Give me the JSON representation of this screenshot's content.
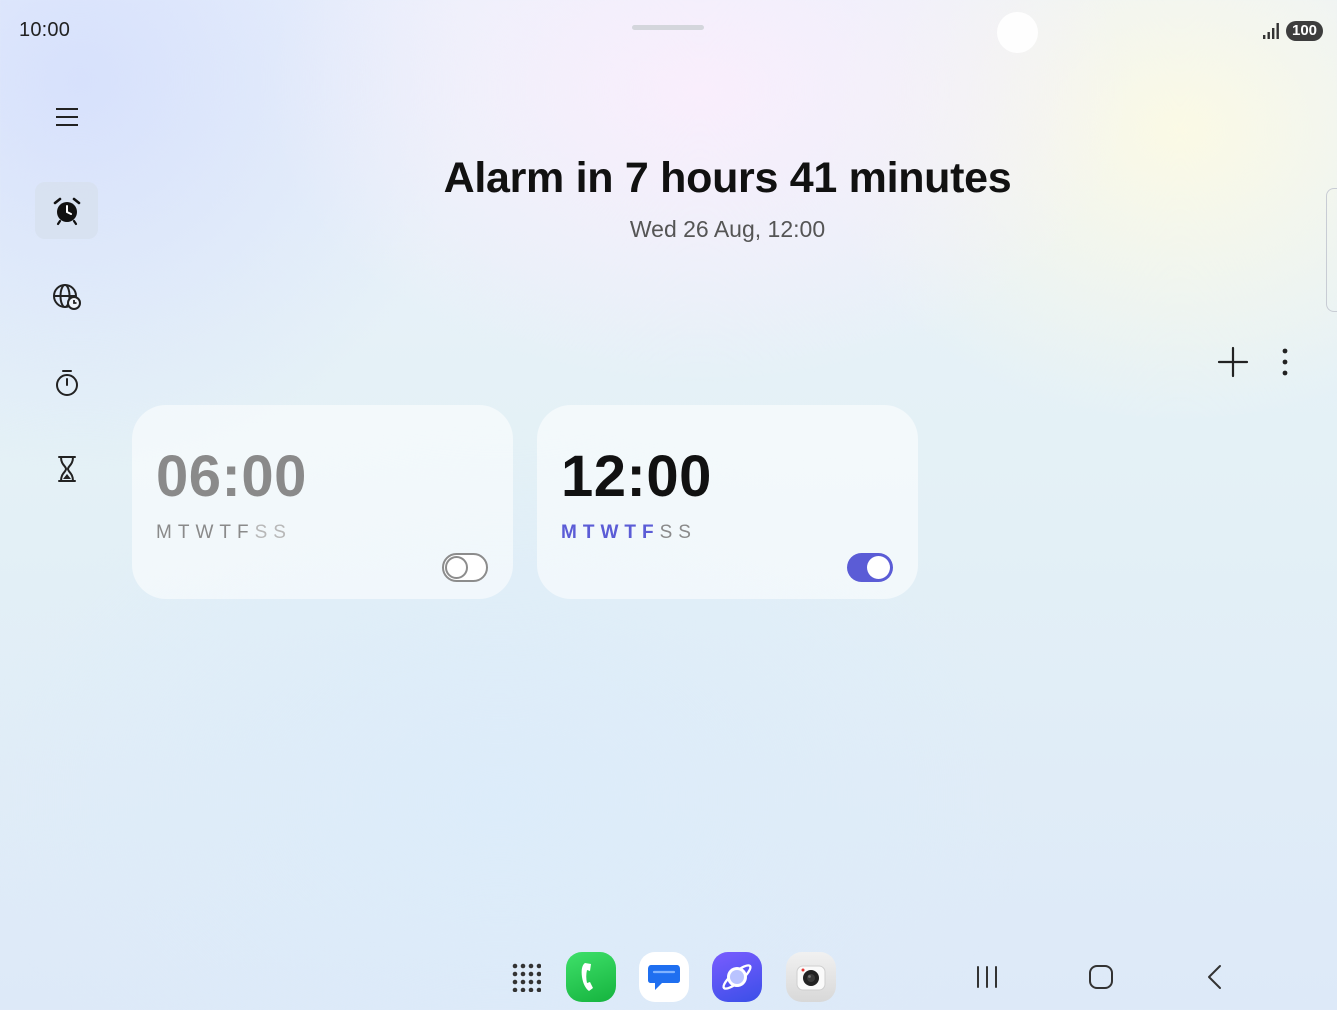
{
  "status_bar": {
    "time": "10:00",
    "battery": "100"
  },
  "sidebar": {
    "items": [
      {
        "name": "menu",
        "icon": "menu-icon"
      },
      {
        "name": "alarm",
        "icon": "alarm-clock-icon",
        "active": true
      },
      {
        "name": "world-clock",
        "icon": "globe-clock-icon"
      },
      {
        "name": "stopwatch",
        "icon": "stopwatch-icon"
      },
      {
        "name": "timer",
        "icon": "hourglass-icon"
      }
    ]
  },
  "header": {
    "title": "Alarm in 7 hours 41 minutes",
    "subtitle": "Wed 26 Aug, 12:00"
  },
  "toolbar": {
    "add_icon": "plus-icon",
    "more_icon": "more-vertical-icon"
  },
  "alarms": [
    {
      "time": "06:00",
      "days": [
        "M",
        "T",
        "W",
        "T",
        "F",
        "S",
        "S"
      ],
      "active_days": [
        true,
        true,
        true,
        true,
        true,
        false,
        false
      ],
      "enabled": false
    },
    {
      "time": "12:00",
      "days": [
        "M",
        "T",
        "W",
        "T",
        "F",
        "S",
        "S"
      ],
      "active_days": [
        true,
        true,
        true,
        true,
        true,
        false,
        false
      ],
      "enabled": true
    }
  ],
  "dock": {
    "apps": [
      {
        "name": "apps",
        "icon": "apps-grid-icon"
      },
      {
        "name": "phone",
        "icon": "phone-icon"
      },
      {
        "name": "messages",
        "icon": "messages-icon"
      },
      {
        "name": "internet",
        "icon": "browser-icon"
      },
      {
        "name": "camera",
        "icon": "camera-icon"
      }
    ],
    "nav": [
      {
        "name": "recents",
        "icon": "recents-icon"
      },
      {
        "name": "home",
        "icon": "home-icon"
      },
      {
        "name": "back",
        "icon": "back-icon"
      }
    ]
  },
  "colors": {
    "accent": "#5b5cd6",
    "day_active_off": "#8a8a8a",
    "day_inactive": "#b8b8b8",
    "time_off": "#8a8a8a",
    "time_on": "#111111"
  }
}
